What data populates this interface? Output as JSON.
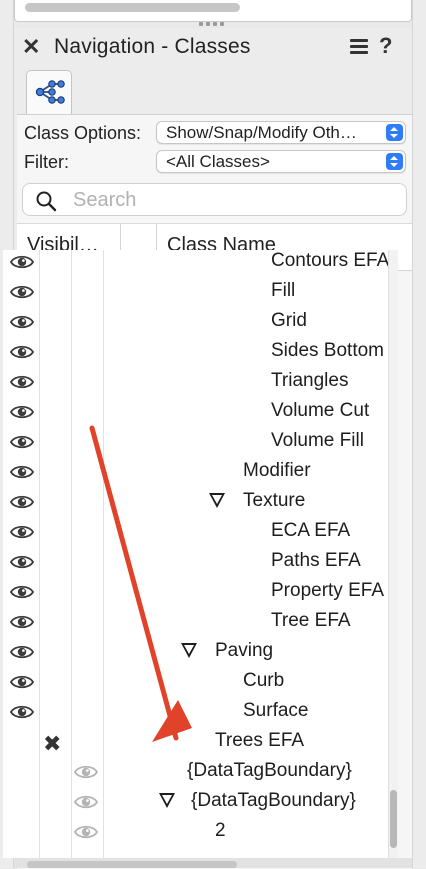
{
  "palette": {
    "title": "Navigation - Classes"
  },
  "options": {
    "class_options_label": "Class Options:",
    "class_options_value": "Show/Snap/Modify Oth…",
    "filter_label": "Filter:",
    "filter_value": "<All Classes>"
  },
  "search": {
    "placeholder": "Search"
  },
  "columns": {
    "visibility": "Visibil…",
    "class_name": "Class Name"
  },
  "rows": [
    {
      "name": "Contours EFA",
      "visibility": "visible",
      "indent": 3,
      "expandable": false
    },
    {
      "name": "Fill",
      "visibility": "visible",
      "indent": 3,
      "expandable": false
    },
    {
      "name": "Grid",
      "visibility": "visible",
      "indent": 3,
      "expandable": false
    },
    {
      "name": "Sides Bottom",
      "visibility": "visible",
      "indent": 3,
      "expandable": false
    },
    {
      "name": "Triangles",
      "visibility": "visible",
      "indent": 3,
      "expandable": false
    },
    {
      "name": "Volume Cut",
      "visibility": "visible",
      "indent": 3,
      "expandable": false
    },
    {
      "name": "Volume Fill",
      "visibility": "visible",
      "indent": 3,
      "expandable": false
    },
    {
      "name": "Modifier",
      "visibility": "visible",
      "indent": 2,
      "expandable": false
    },
    {
      "name": "Texture",
      "visibility": "visible",
      "indent": 2,
      "expandable": true
    },
    {
      "name": "ECA EFA",
      "visibility": "visible",
      "indent": 3,
      "expandable": false
    },
    {
      "name": "Paths EFA",
      "visibility": "visible",
      "indent": 3,
      "expandable": false
    },
    {
      "name": "Property EFA",
      "visibility": "visible",
      "indent": 3,
      "expandable": false
    },
    {
      "name": "Tree EFA",
      "visibility": "visible",
      "indent": 3,
      "expandable": false
    },
    {
      "name": "Paving",
      "visibility": "visible",
      "indent": 1,
      "expandable": true
    },
    {
      "name": "Curb",
      "visibility": "visible",
      "indent": 2,
      "expandable": false
    },
    {
      "name": "Surface",
      "visibility": "visible",
      "indent": 2,
      "expandable": false
    },
    {
      "name": "Trees EFA",
      "visibility": "hidden",
      "indent": 1,
      "expandable": false
    },
    {
      "name": "{DataTagBoundary}",
      "visibility": "grayed",
      "indent": 0,
      "expandable": false
    },
    {
      "name": "{DataTagBoundary}",
      "visibility": "grayed",
      "indent": 0,
      "expandable": true
    },
    {
      "name": "2",
      "visibility": "grayed",
      "indent": 1,
      "expandable": false
    }
  ],
  "icons": {
    "close": "close-icon",
    "menu": "menu-icon",
    "help": "help-icon",
    "tab": "class-hierarchy-icon",
    "search": "search-icon",
    "eye": "eye-icon",
    "hidden": "hidden-x-icon"
  },
  "colors": {
    "accent": "#2f7cf6",
    "annotation_arrow": "#e1432a",
    "eye_visible": "#3c3c3c",
    "eye_grayed": "#b4b4b4"
  }
}
